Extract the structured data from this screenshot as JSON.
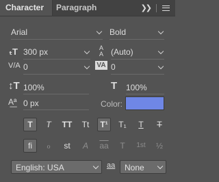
{
  "tabs": [
    {
      "label": "Character"
    },
    {
      "label": "Paragraph"
    }
  ],
  "header_icons": {
    "expand": "double-chevron-right-icon",
    "menu": "hamburger-icon"
  },
  "font": {
    "family": "Arial",
    "style": "Bold"
  },
  "size": {
    "value": "300 px"
  },
  "leading": {
    "value": "(Auto)"
  },
  "kerning": {
    "value": "0"
  },
  "tracking": {
    "value": "0"
  },
  "vertical_scale": {
    "value": "100%"
  },
  "horizontal_scale": {
    "value": "100%"
  },
  "baseline_shift": {
    "value": "0 px"
  },
  "color": {
    "label": "Color:",
    "value": "#6f87e6"
  },
  "style_buttons": [
    {
      "glyph": "T",
      "name": "faux-bold",
      "state": "on"
    },
    {
      "glyph": "T",
      "name": "faux-italic",
      "state": "off"
    },
    {
      "glyph": "TT",
      "name": "all-caps",
      "state": "off"
    },
    {
      "glyph": "Tt",
      "name": "small-caps",
      "state": "off"
    },
    {
      "glyph": "T¹",
      "name": "superscript",
      "state": "on"
    },
    {
      "glyph": "T₁",
      "name": "subscript",
      "state": "off"
    },
    {
      "glyph": "T",
      "name": "underline",
      "state": "off"
    },
    {
      "glyph": "T",
      "name": "strikethrough",
      "state": "off"
    }
  ],
  "opentype_buttons": [
    {
      "glyph": "fi",
      "name": "standard-ligatures",
      "state": "on"
    },
    {
      "glyph": "ℴ",
      "name": "contextual-alternates",
      "state": "dim"
    },
    {
      "glyph": "st",
      "name": "discretionary-ligatures",
      "state": "off"
    },
    {
      "glyph": "A",
      "name": "swash",
      "state": "dim"
    },
    {
      "glyph": "aa",
      "name": "stylistic-alternates",
      "state": "dim"
    },
    {
      "glyph": "T",
      "name": "titling-alternates",
      "state": "dim"
    },
    {
      "glyph": "1st",
      "name": "ordinals",
      "state": "dim"
    },
    {
      "glyph": "½",
      "name": "fractions",
      "state": "dim"
    }
  ],
  "language": {
    "value": "English: USA"
  },
  "antialias": {
    "icon_label": "aa",
    "value": "None"
  }
}
